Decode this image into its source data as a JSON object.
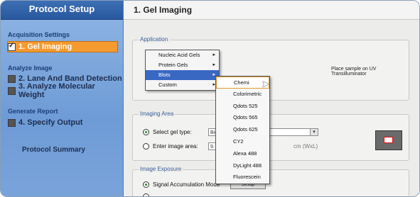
{
  "sidebar": {
    "title": "Protocol Setup",
    "sections": [
      {
        "label": "Acquisition Settings"
      },
      {
        "label": "Analyze Image"
      },
      {
        "label": "Generate Report"
      }
    ],
    "items": [
      {
        "label": "1. Gel Imaging",
        "checked": true
      },
      {
        "label": "2. Lane And Band Detection"
      },
      {
        "label": "3. Analyze Molecular Weight"
      },
      {
        "label": "4. Specify Output"
      }
    ],
    "summary": "Protocol Summary"
  },
  "main": {
    "title": "1. Gel Imaging",
    "application": {
      "group_title": "Application",
      "note": "Place sample on UV Transilluminator"
    },
    "app_menu": [
      {
        "label": "Nucleic Acid Gels",
        "arrow": "▸"
      },
      {
        "label": "Protein Gels",
        "arrow": "▸"
      },
      {
        "label": "Blots",
        "arrow": "▸",
        "selected": true
      },
      {
        "label": "Custom",
        "arrow": "▸"
      }
    ],
    "blots_submenu": [
      "Chemi",
      "Colorimetric",
      "Qdots 525",
      "Qdots 565",
      "Qdots 625",
      "CY2",
      "Alexa 488",
      "DyLight 488",
      "Fluorescein"
    ],
    "imaging_area": {
      "group_title": "Imaging Area",
      "select_label": "Select gel type:",
      "select_value": "Bio",
      "enter_label": "Enter image area:",
      "enter_value": "9.",
      "unit": "cm (WxL)"
    },
    "image_exposure": {
      "group_title": "Image Exposure",
      "signal_label": "Signal Accumulation Mode",
      "setup_label": "Setup"
    }
  },
  "colors": {
    "accent": "#f59a2f",
    "sidebar": "#7aa3da",
    "menu_select": "#3968c2"
  }
}
